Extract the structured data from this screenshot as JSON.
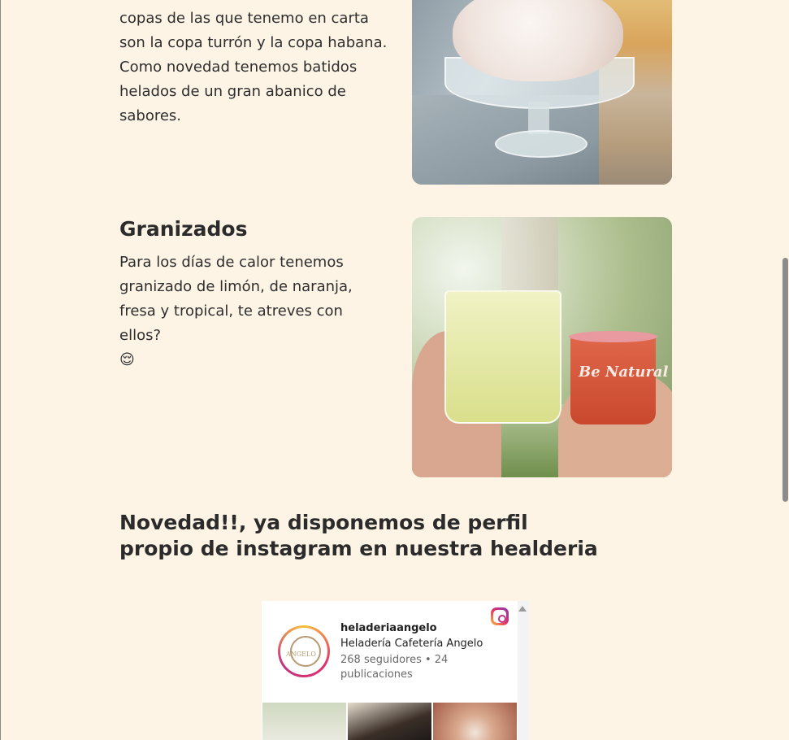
{
  "copas_section": {
    "paragraph_partial": "copas de las que tenemo en carta son la copa turrón y la copa habana. Como novedad tenemos batidos helados de un gran abanico de sabores."
  },
  "granizados_section": {
    "title": "Granizados",
    "paragraph": "Para los días de calor tenemos granizado de limón, de naranja, fresa y tropical, te atreves con ellos?",
    "emoji": "😌"
  },
  "instagram_section": {
    "heading": "Novedad!!, ya disponemos de perfil propio de instagram en nuestra healderia"
  },
  "instagram_widget": {
    "handle": "heladeriaangelo",
    "display_name": "Heladería Cafetería Angelo",
    "stats": "268 seguidores • 24 publicaciones",
    "avatar_text": "ANGELO",
    "granizado_cup_text": "Be Natural"
  }
}
